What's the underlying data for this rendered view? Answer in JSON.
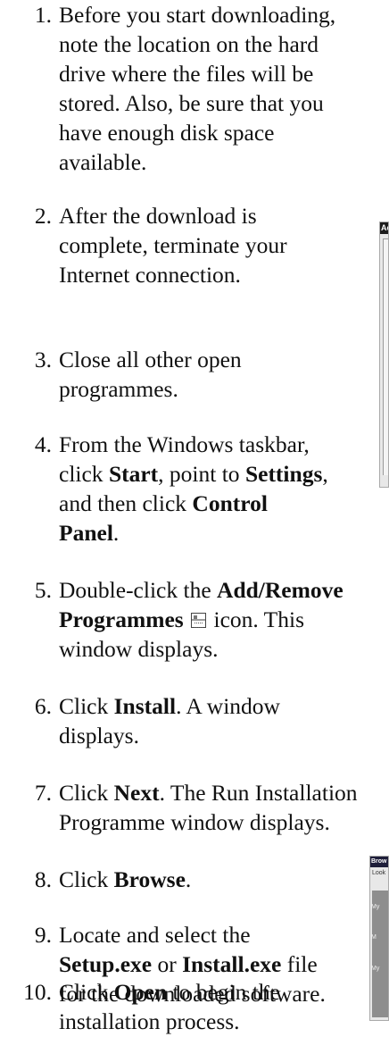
{
  "steps": [
    {
      "number": "1.",
      "lines": [
        "Before you start downloading,",
        "note the location on the hard",
        "drive where the files will be",
        "stored. Also, be sure that you",
        "have enough disk space",
        "available."
      ]
    },
    {
      "number": "2.",
      "lines": [
        "After the download is",
        "complete, terminate your",
        "Internet connection."
      ]
    },
    {
      "number": "3.",
      "lines": [
        "Close all other open",
        "programmes."
      ]
    },
    {
      "number": "4.",
      "line1": "From the Windows taskbar,",
      "line2_a": "click ",
      "line2_b": "Start",
      "line2_c": ", point to ",
      "line2_d": "Settings",
      "line2_e": ",",
      "line3_a": "and then click ",
      "line3_b": "Control",
      "line4_a": "Panel",
      "line4_b": "."
    },
    {
      "number": "5.",
      "line1_a": "Double-click the ",
      "line1_b": "Add/Remove",
      "line2_a": "Programmes",
      "line2_b": " icon. This",
      "line3": "window displays.",
      "icon": "add-remove-programs-icon"
    },
    {
      "number": "6.",
      "line1_a": "Click ",
      "line1_b": "Install",
      "line1_c": ". A window",
      "line2": "displays."
    },
    {
      "number": "7.",
      "line1_a": "Click ",
      "line1_b": "Next",
      "line1_c": ". The Run Installation",
      "line2": "Programme window displays."
    },
    {
      "number": "8.",
      "line1_a": "Click ",
      "line1_b": "Browse",
      "line1_c": "."
    },
    {
      "number": "9.",
      "line1": "Locate and select the",
      "line2_a": "Setup.exe",
      "line2_b": " or ",
      "line2_c": "Install.exe",
      "line2_d": " file",
      "line3": "for the downloaded software."
    },
    {
      "number": "10.",
      "line1_a": "Click ",
      "line1_b": "Open",
      "line1_c": " to begin the",
      "line2": "installation process."
    }
  ],
  "thumbnails": {
    "a_title": "Ac",
    "b_title": "Brow",
    "b_lookin": "Look",
    "b_labels": [
      "My",
      "M",
      "My"
    ]
  }
}
